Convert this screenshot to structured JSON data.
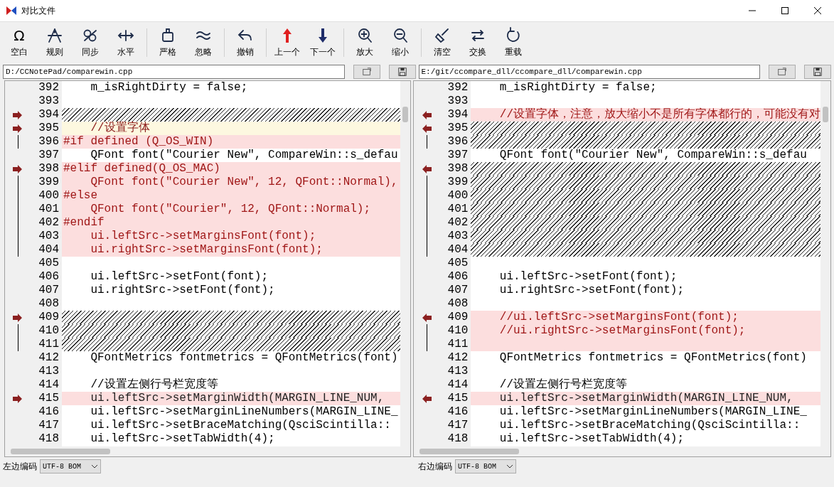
{
  "window": {
    "title": "对比文件"
  },
  "toolbar": [
    [
      {
        "icon": "Ω",
        "label": "空白"
      },
      {
        "label": "规则"
      },
      {
        "label": "同步"
      },
      {
        "label": "水平"
      }
    ],
    [
      {
        "label": "严格"
      },
      {
        "label": "忽略"
      }
    ],
    [
      {
        "label": "撤销"
      }
    ],
    [
      {
        "label": "上一个"
      },
      {
        "label": "下一个"
      }
    ],
    [
      {
        "label": "放大"
      },
      {
        "label": "缩小"
      }
    ],
    [
      {
        "label": "清空"
      },
      {
        "label": "交换"
      },
      {
        "label": "重载"
      }
    ]
  ],
  "panes": [
    {
      "kind": "left",
      "path": "D:/CCNotePad/comparewin.cpp",
      "encoding_label": "左边编码",
      "encoding": "UTF-8 BOM",
      "lines": [
        {
          "num": "392",
          "kind": "normal",
          "text": "    m_isRightDirty = false;"
        },
        {
          "num": "393",
          "kind": "normal"
        },
        {
          "num": "394",
          "kind": "missing",
          "marker": {
            "kind": "arrow"
          }
        },
        {
          "num": "395",
          "kind": "moved",
          "marker": {
            "kind": "arrow"
          },
          "text": "    //设置字体"
        },
        {
          "num": "396",
          "kind": "changed",
          "marker": {
            "kind": "bar"
          },
          "text": "#if defined (Q_OS_WIN)"
        },
        {
          "num": "397",
          "kind": "normal",
          "text": "    QFont font(\"Courier New\", CompareWin::s_defau"
        },
        {
          "num": "398",
          "kind": "changed",
          "marker": {
            "kind": "arrow"
          },
          "text": "#elif defined(Q_OS_MAC)"
        },
        {
          "num": "399",
          "kind": "changed",
          "marker": {
            "kind": "bar"
          },
          "text": "    QFont font(\"Courier New\", 12, QFont::Normal),"
        },
        {
          "num": "400",
          "kind": "changed",
          "marker": {
            "kind": "bar"
          },
          "text": "#else"
        },
        {
          "num": "401",
          "kind": "changed",
          "marker": {
            "kind": "bar"
          },
          "text": "    QFont font(\"Courier\", 12, QFont::Normal);"
        },
        {
          "num": "402",
          "kind": "changed",
          "marker": {
            "kind": "bar"
          },
          "text": "#endif"
        },
        {
          "num": "403",
          "kind": "changed",
          "marker": {
            "kind": "bar"
          },
          "text": "    ui.leftSrc->setMarginsFont(font);"
        },
        {
          "num": "404",
          "kind": "changed",
          "marker": {
            "kind": "bar"
          },
          "text": "    ui.rightSrc->setMarginsFont(font);"
        },
        {
          "num": "405",
          "kind": "normal"
        },
        {
          "num": "406",
          "kind": "normal",
          "text": "    ui.leftSrc->setFont(font);"
        },
        {
          "num": "407",
          "kind": "normal",
          "text": "    ui.rightSrc->setFont(font);"
        },
        {
          "num": "408",
          "kind": "normal"
        },
        {
          "num": "409",
          "kind": "missing",
          "marker": {
            "kind": "arrow"
          }
        },
        {
          "num": "410",
          "kind": "missing",
          "marker": {
            "kind": "bar"
          }
        },
        {
          "num": "411",
          "kind": "missing",
          "marker": {
            "kind": "bar"
          }
        },
        {
          "num": "412",
          "kind": "normal",
          "text": "    QFontMetrics fontmetrics = QFontMetrics(font)"
        },
        {
          "num": "413",
          "kind": "normal"
        },
        {
          "num": "414",
          "kind": "normal",
          "text": "    //设置左侧行号栏宽度等"
        },
        {
          "num": "415",
          "kind": "edited",
          "marker": {
            "kind": "arrow"
          },
          "text": "    ui.leftSrc->setMarginWidth(MARGIN_LINE_NUM,"
        },
        {
          "num": "416",
          "kind": "normal",
          "text": "    ui.leftSrc->setMarginLineNumbers(MARGIN_LINE_"
        },
        {
          "num": "417",
          "kind": "normal",
          "text": "    ui.leftSrc->setBraceMatching(QsciScintilla::"
        },
        {
          "num": "418",
          "kind": "normal",
          "text": "    ui.leftSrc->setTabWidth(4);"
        }
      ]
    },
    {
      "kind": "right",
      "path": "E:/git/ccompare_dll/ccompare_dll/comparewin.cpp",
      "encoding_label": "右边编码",
      "encoding": "UTF-8 BOM",
      "lines": [
        {
          "num": "392",
          "kind": "normal",
          "text": "    m_isRightDirty = false;"
        },
        {
          "num": "393",
          "kind": "normal"
        },
        {
          "num": "394",
          "kind": "changed",
          "marker": {
            "kind": "arrow"
          },
          "text": "    //设置字体，注意，放大缩小不是所有字体都行的，可能没有对"
        },
        {
          "num": "395",
          "kind": "missing",
          "marker": {
            "kind": "arrow"
          }
        },
        {
          "num": "396",
          "kind": "missing",
          "marker": {
            "kind": "bar"
          }
        },
        {
          "num": "397",
          "kind": "normal",
          "text": "    QFont font(\"Courier New\", CompareWin::s_defau"
        },
        {
          "num": "398",
          "kind": "missing",
          "marker": {
            "kind": "arrow"
          }
        },
        {
          "num": "399",
          "kind": "missing",
          "marker": {
            "kind": "bar"
          }
        },
        {
          "num": "400",
          "kind": "missing",
          "marker": {
            "kind": "bar"
          }
        },
        {
          "num": "401",
          "kind": "missing",
          "marker": {
            "kind": "bar"
          }
        },
        {
          "num": "402",
          "kind": "missing",
          "marker": {
            "kind": "bar"
          }
        },
        {
          "num": "403",
          "kind": "missing",
          "marker": {
            "kind": "bar"
          }
        },
        {
          "num": "404",
          "kind": "missing",
          "marker": {
            "kind": "bar"
          }
        },
        {
          "num": "405",
          "kind": "normal"
        },
        {
          "num": "406",
          "kind": "normal",
          "text": "    ui.leftSrc->setFont(font);"
        },
        {
          "num": "407",
          "kind": "normal",
          "text": "    ui.rightSrc->setFont(font);"
        },
        {
          "num": "408",
          "kind": "normal"
        },
        {
          "num": "409",
          "kind": "changed",
          "marker": {
            "kind": "arrow"
          },
          "text": "    //ui.leftSrc->setMarginsFont(font);"
        },
        {
          "num": "410",
          "kind": "changed",
          "marker": {
            "kind": "bar"
          },
          "text": "    //ui.rightSrc->setMarginsFont(font);"
        },
        {
          "num": "411",
          "kind": "changed",
          "marker": {
            "kind": "bar"
          }
        },
        {
          "num": "412",
          "kind": "normal",
          "text": "    QFontMetrics fontmetrics = QFontMetrics(font)"
        },
        {
          "num": "413",
          "kind": "normal"
        },
        {
          "num": "414",
          "kind": "normal",
          "text": "    //设置左侧行号栏宽度等"
        },
        {
          "num": "415",
          "kind": "edited",
          "marker": {
            "kind": "arrow"
          },
          "text": "    ui.leftSrc->setMarginWidth(MARGIN_LINE_NUM,"
        },
        {
          "num": "416",
          "kind": "normal",
          "text": "    ui.leftSrc->setMarginLineNumbers(MARGIN_LINE_"
        },
        {
          "num": "417",
          "kind": "normal",
          "text": "    ui.leftSrc->setBraceMatching(QsciScintilla::"
        },
        {
          "num": "418",
          "kind": "normal",
          "text": "    ui.leftSrc->setTabWidth(4);"
        }
      ]
    }
  ]
}
